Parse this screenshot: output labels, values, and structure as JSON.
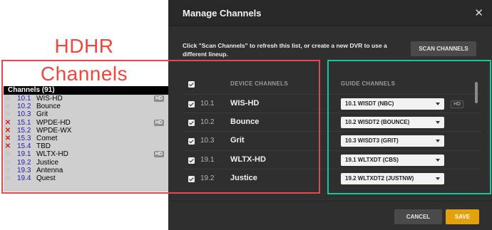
{
  "hdhr": {
    "title_line1": "HDHR",
    "title_line2": "Channels",
    "list_header": "Channels (91)",
    "rows": [
      {
        "num": "10.1",
        "name": "WIS-HD",
        "mark": "star",
        "badge": "HD"
      },
      {
        "num": "10.2",
        "name": "Bounce",
        "mark": "star",
        "badge": ""
      },
      {
        "num": "10.3",
        "name": "Grit",
        "mark": "star",
        "badge": ""
      },
      {
        "num": "15.1",
        "name": "WPDE-HD",
        "mark": "x",
        "badge": "HD"
      },
      {
        "num": "15.2",
        "name": "WPDE-WX",
        "mark": "x",
        "badge": ""
      },
      {
        "num": "15.3",
        "name": "Comet",
        "mark": "x",
        "badge": ""
      },
      {
        "num": "15.4",
        "name": "TBD",
        "mark": "x",
        "badge": ""
      },
      {
        "num": "19.1",
        "name": "WLTX-HD",
        "mark": "star",
        "badge": "HD"
      },
      {
        "num": "19.2",
        "name": "Justice",
        "mark": "star",
        "badge": ""
      },
      {
        "num": "19.3",
        "name": "Antenna",
        "mark": "star",
        "badge": ""
      },
      {
        "num": "19.4",
        "name": "Quest",
        "mark": "star",
        "badge": ""
      }
    ],
    "star_glyph": "☆",
    "x_glyph": "✕"
  },
  "modal": {
    "title": "Manage Channels",
    "close_glyph": "✕",
    "info_text": "Click \"Scan Channels\" to refresh this list, or create a new DVR to use a different lineup.",
    "scan_label": "SCAN CHANNELS",
    "device_header": "DEVICE CHANNELS",
    "guide_header": "GUIDE CHANNELS",
    "channels": [
      {
        "num": "10.1",
        "name": "WIS-HD",
        "guide": "10.1 WISDT (NBC)",
        "hd": "HD"
      },
      {
        "num": "10.2",
        "name": "Bounce",
        "guide": "10.2 WISDT2 (BOUNCE)",
        "hd": ""
      },
      {
        "num": "10.3",
        "name": "Grit",
        "guide": "10.3 WISDT3 (GRIT)",
        "hd": ""
      },
      {
        "num": "19.1",
        "name": "WLTX-HD",
        "guide": "19.1 WLTXDT (CBS)",
        "hd": ""
      },
      {
        "num": "19.2",
        "name": "Justice",
        "guide": "19.2 WLTXDT2 (JUSTNW)",
        "hd": ""
      }
    ],
    "cancel_label": "CANCEL",
    "save_label": "SAVE"
  },
  "colors": {
    "modal_bg": "#2f2f2f",
    "accent_save": "#e5a00d",
    "annotation_red": "#e04a4a",
    "annotation_teal": "#1cc39c",
    "hdhr_number_blue": "#1e1eb4",
    "hdhr_x_red": "#d81a1a"
  }
}
